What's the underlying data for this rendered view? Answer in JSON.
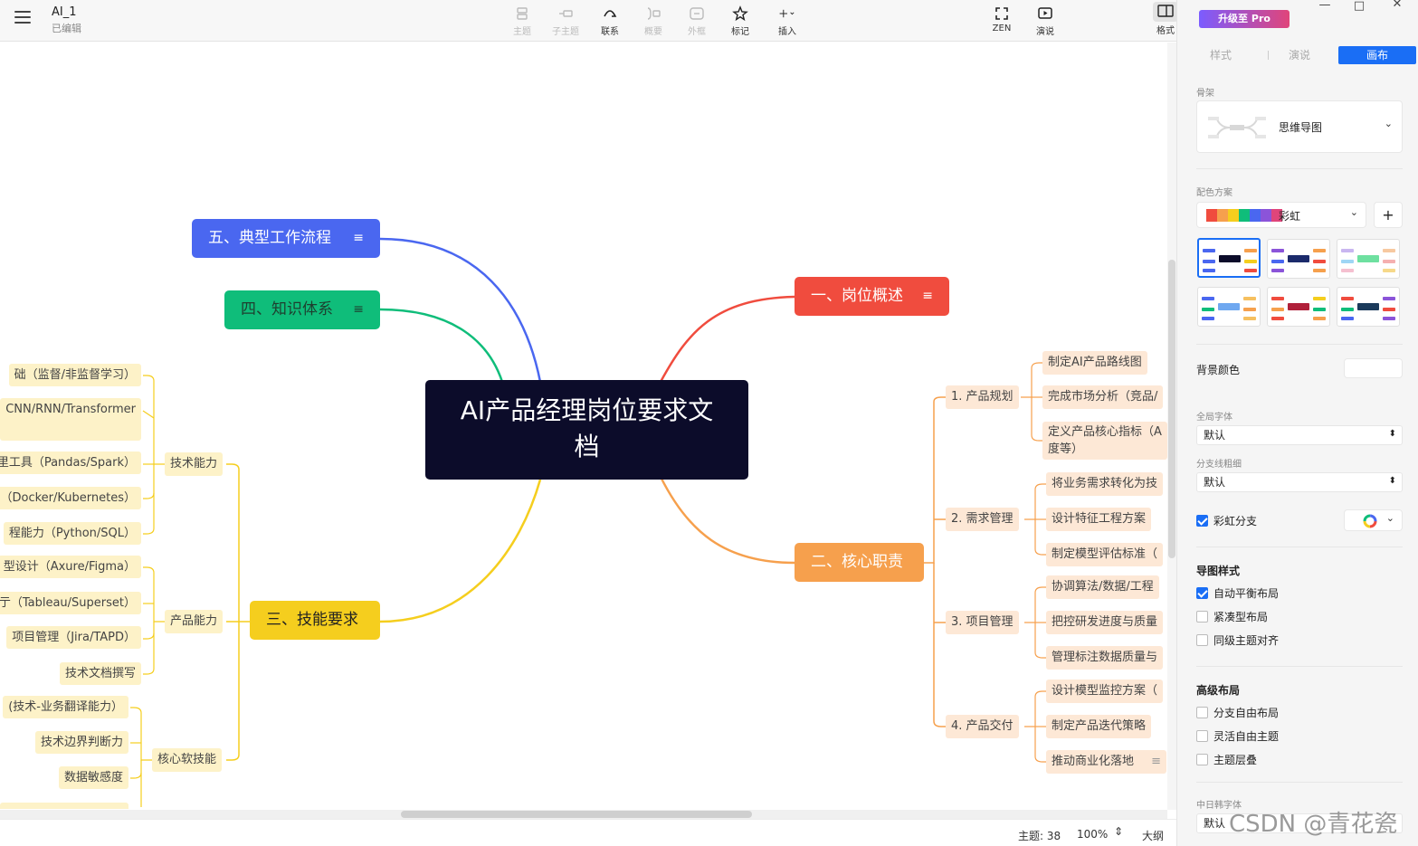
{
  "topbar": {
    "doc_title": "AI_1",
    "doc_status": "已编辑",
    "tools": {
      "topic": "主题",
      "subtopic": "子主题",
      "relation": "联系",
      "summary": "概要",
      "boundary": "外框",
      "marker": "标记",
      "insert": "插入",
      "zen": "ZEN",
      "present": "演说",
      "format": "格式"
    }
  },
  "panel": {
    "pro_label": "升级至 Pro",
    "tabs": {
      "style": "样式",
      "present": "演说",
      "canvas": "画布"
    },
    "skeleton_label": "骨架",
    "skeleton_value": "思维导图",
    "color_scheme_label": "配色方案",
    "color_scheme_value": "彩虹",
    "add_symbol": "+",
    "bg_color_label": "背景颜色",
    "global_font_label": "全局字体",
    "global_font_value": "默认",
    "branch_width_label": "分支线粗细",
    "branch_width_value": "默认",
    "rainbow_branch_label": "彩虹分支",
    "map_style_title": "导图样式",
    "auto_balance": "自动平衡布局",
    "compact": "紧凑型布局",
    "align_same_level": "同级主题对齐",
    "advanced_title": "高级布局",
    "free_branch": "分支自由布局",
    "free_topic": "灵活自由主题",
    "topic_overlap": "主题层叠",
    "cjk_font_label": "中日韩字体",
    "cjk_font_value": "默认"
  },
  "colors": {
    "accent": "#1a6ef5",
    "central": "#0c0c2a",
    "branch1": "#f04c3e",
    "branch2": "#f6a04d",
    "branch3": "#f5ce1e",
    "branch4": "#0fbd7a",
    "branch5": "#4a67f0"
  },
  "map": {
    "central": {
      "line1": "AI产品经理岗位要求文",
      "line2": "档"
    },
    "branches": {
      "b1": "一、岗位概述",
      "b2": "二、核心职责",
      "b3": "三、技能要求",
      "b4": "四、知识体系",
      "b5": "五、典型工作流程"
    },
    "note_icon": "≡",
    "core": {
      "s1": "1. 产品规划",
      "s2": "2. 需求管理",
      "s3": "3. 项目管理",
      "s4": "4. 产品交付",
      "s1_items": [
        "制定AI产品路线图",
        "完成市场分析（竞品/",
        "定义产品核心指标（A",
        "度等）"
      ],
      "s2_items": [
        "将业务需求转化为技",
        "设计特征工程方案",
        "制定模型评估标准（"
      ],
      "s3_items": [
        "协调算法/数据/工程",
        "把控研发进度与质量",
        "管理标注数据质量与"
      ],
      "s4_items": [
        "设计模型监控方案（",
        "制定产品迭代策略",
        "推动商业化落地"
      ]
    },
    "skills": {
      "tech": "技术能力",
      "product": "产品能力",
      "soft": "核心软技能",
      "tech_items": [
        "础（监督/非监督学习）",
        "CNN/RNN/Transformer",
        "里工具（Pandas/Spark）",
        "（Docker/Kubernetes）",
        "程能力（Python/SQL）"
      ],
      "product_items": [
        "型设计（Axure/Figma）",
        "亍（Tableau/Superset）",
        "项目管理（Jira/TAPD）",
        "技术文档撰写"
      ],
      "soft_items": [
        "(技术-业务翻译能力）",
        "技术边界判断力",
        "数据敏感度"
      ]
    }
  },
  "status": {
    "topics": "主题: 38",
    "zoom": "100%",
    "outline": "大纲"
  },
  "watermark": "CSDN @青花瓷"
}
